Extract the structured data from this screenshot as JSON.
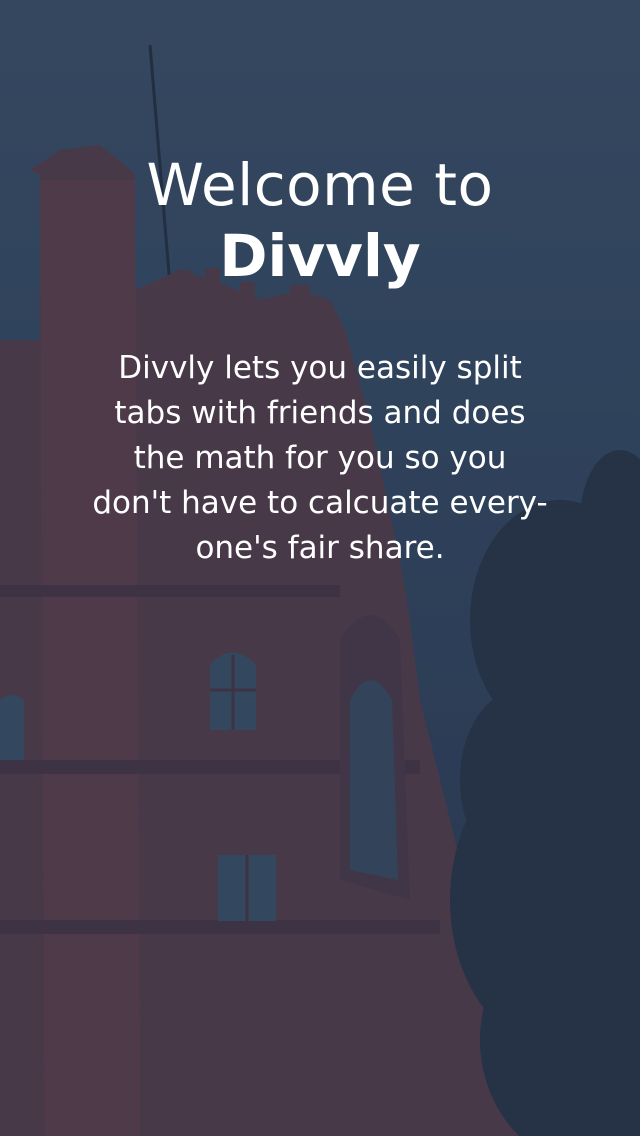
{
  "welcome": {
    "title_line1": "Welcome to",
    "title_line2": "Divvly",
    "description": "Divvly lets you easily split\ntabs with friends and does\nthe math for you so you\ndon't have to calcuate every-\none's fair share."
  },
  "colors": {
    "sky": "#3c5168",
    "overlay": "#2d3a52",
    "brick": "#6b3a3e",
    "text": "#ffffff"
  }
}
